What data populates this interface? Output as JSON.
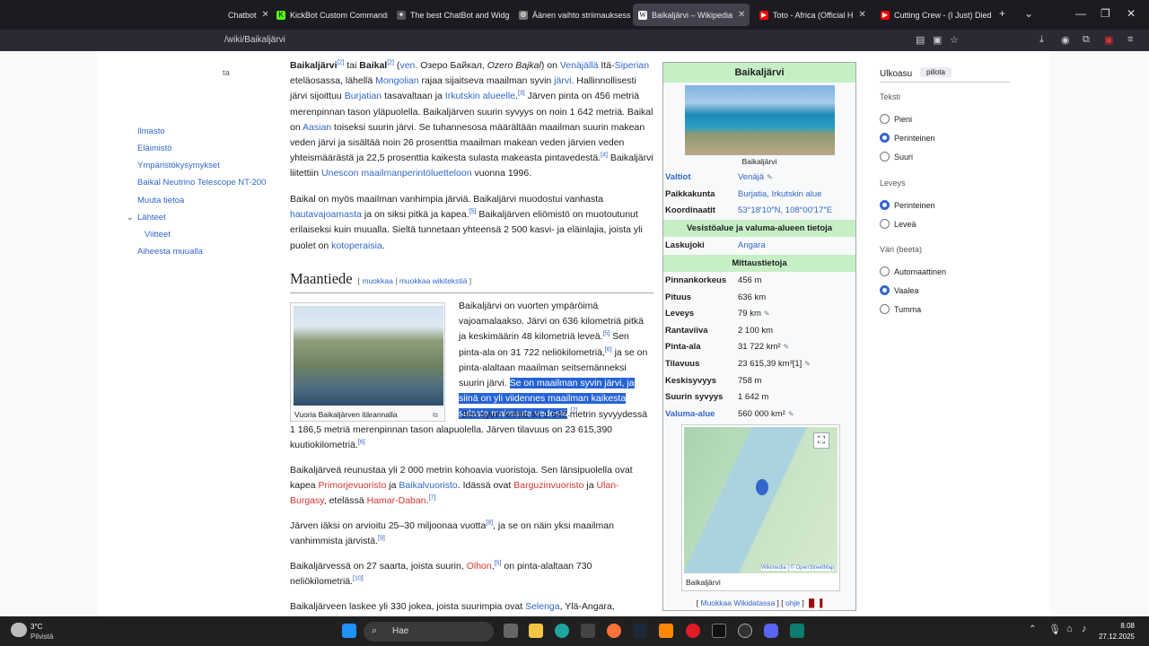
{
  "tabs": [
    {
      "label": "Chatbot",
      "icon": "tab-icon",
      "color": "#444"
    },
    {
      "label": "KickBot Custom Commands",
      "icon": "kickbot-icon",
      "color": "#53fc18"
    },
    {
      "label": "The best ChatBot and Widg",
      "icon": "streamelements-icon",
      "color": "#555"
    },
    {
      "label": "Äänen vaihto striimauksess",
      "icon": "chatgpt-icon",
      "color": "#777"
    },
    {
      "label": "Baikaljärvi – Wikipedia",
      "icon": "wikipedia-icon",
      "color": "#fff"
    },
    {
      "label": "Toto - Africa (Official H",
      "icon": "youtube-icon",
      "color": "#ff0000"
    },
    {
      "label": "Cutting Crew - (I Just) Died",
      "icon": "youtube-icon",
      "color": "#ff0000"
    }
  ],
  "url": "/wiki/Baikaljärvi",
  "toc": [
    "Ilmasto",
    "Eläimistö",
    "Ympäristökysymykset",
    "Baikal Neutrino Telescope NT-200",
    "Muuta tietoa",
    "Lähteet",
    "Viitteet",
    "Aiheesta muualla"
  ],
  "toc_partial": "ta",
  "article": {
    "p1": {
      "b1": "Baikaljärvi",
      "s1": "[2]",
      "t1": " tai ",
      "b2": "Baikal",
      "s2": "[2]",
      "t2": " (",
      "l1": "ven.",
      "t3": " Озеро Байкал, ",
      "i1": "Ozero Bajkal",
      "t4": ") on ",
      "l2": "Venäjällä",
      "t5": " Itä-",
      "l3": "Siperian",
      "t6": " eteläosassa, lähellä ",
      "l4": "Mongolian",
      "t7": " rajaa sijaitseva maailman syvin ",
      "l5": "järvi",
      "t8": ". Hallinnollisesti järvi sijoittuu ",
      "l6": "Burjatian",
      "t9": " tasavaltaan ja ",
      "l7": "Irkutskin alueelle",
      "t10": ".",
      "s3": "[3]",
      "t11": " Järven pinta on 456 metriä merenpinnan tason yläpuolella. Baikaljärven suurin syvyys on noin 1 642 metriä. Baikal on ",
      "l8": "Aasian",
      "t12": " toiseksi suurin järvi. Se tuhannesosa määrältään maailman suurin makean veden järvi ja sisältää noin 26 prosenttia maailman makean veden järvien veden yhteismäärästä ja 22,5 prosenttia kaikesta sulasta makeasta pintavedestä.",
      "s4": "[4]",
      "t13": " Baikaljärvi liitettiin ",
      "l9": "Unescon maailmanperintöluetteloon",
      "t14": " vuonna 1996."
    },
    "p2": {
      "t1": "Baikal on myös maailman vanhimpia järviä. Baikaljärvi muodostui vanhasta ",
      "l1": "hautavajoamasta",
      "t2": " ja on siksi pitkä ja kapea.",
      "s1": "[5]",
      "t3": " Baikaljärven eliömistö on muotoutunut erilaiseksi kuin muualla. Sieltä tunnetaan yhteensä 2 500 kasvi- ja eläinlajia, joista yli puolet on ",
      "l2": "kotoperaisia",
      "t4": "."
    },
    "heading": "Maantiede",
    "edit1": "muokkaa",
    "edit2": "muokkaa wikitekstiä",
    "thumb_caption": "Vuoria Baikaljärven itärannalla",
    "p3": {
      "t1": "Baikaljärvi on vuorten ympäröimä vajoamalaakso. Järvi on 636 kilometriä pitkä ja keskimäärin 48 kilometriä leveä.",
      "s1": "[5]",
      "t2": " Sen pinta-ala on 31 722 neliökilometriä,",
      "s2": "[6]",
      "t3": " ja se on pinta-alaltaan maailman seitsemänneksi suurin järvi. ",
      "h1": "Se on maailman syvin järvi, ja siinä on yli viidennes maailman kaikesta sulasta makeasta vedestä",
      "t4": ".",
      "s3": "[7]",
      "t5": " Sen syvin kohta on 1 642 metrin syvyydessä 1 186,5 metriä merenpinnan tason alapuolella. Järven tilavuus on 23 615,390 kuutiokilometriä.",
      "s4": "[6]"
    },
    "p4": {
      "t1": "Baikaljärveä reunustaa yli 2 000 metrin kohoavia vuoristoja. Sen länsipuolella ovat kapea ",
      "l1": "Primorjevuoristo",
      "t2": " ja ",
      "l2": "Baikalvuoristo",
      "t3": ". Idässä ovat ",
      "l3": "Barguzinvuoristo",
      "t4": " ja ",
      "l4": "Ulan-Burgasy",
      "t5": ", etelässä ",
      "l5": "Hamar-Daban",
      "t6": ".",
      "s1": "[7]"
    },
    "p5": {
      "t1": "Järven iäksi on arvioitu 25–30 miljoonaa vuotta",
      "s1": "[8]",
      "t2": ", ja se on näin yksi maailman vanhimmista järvistä.",
      "s2": "[9]"
    },
    "p6": {
      "t1": "Baikaljärvessä on 27 saarta, joista suurin, ",
      "l1": "Olhon",
      "t2": ",",
      "s1": "[5]",
      "t3": " on pinta-alaltaan 730 neliökilometriä.",
      "s2": "[10]"
    },
    "p7": {
      "t1": "Baikaljärveen laskee yli 330 jokea, joista suurimpia ovat ",
      "l1": "Selenga",
      "t2": ", Ylä-Angara,"
    }
  },
  "infobox": {
    "title": "Baikaljärvi",
    "image_caption": "Baikaljärvi",
    "rows1": [
      {
        "k": "Valtiot",
        "v": "Venäjä",
        "klink": true,
        "vlink": true,
        "pen": true
      },
      {
        "k": "Paikkakunta",
        "v": "Burjatia, Irkutskin alue",
        "klink": false,
        "vlink": true,
        "pen": false
      },
      {
        "k": "Koordinaatit",
        "v": "53°18′10″N, 108°00′17″E",
        "klink": false,
        "vlink": true,
        "pen": false
      }
    ],
    "section1": "Vesistöalue ja valuma-alueen tietoja",
    "rows2": [
      {
        "k": "Laskujoki",
        "v": "Angara",
        "klink": false,
        "vlink": true,
        "pen": false
      }
    ],
    "section2": "Mittaustietoja",
    "rows3": [
      {
        "k": "Pinnankorkeus",
        "v": "456 m",
        "klink": false,
        "vlink": false,
        "pen": false
      },
      {
        "k": "Pituus",
        "v": "636 km",
        "klink": false,
        "vlink": false,
        "pen": false
      },
      {
        "k": "Leveys",
        "v": "79 km",
        "klink": false,
        "vlink": false,
        "pen": true
      },
      {
        "k": "Rantaviiva",
        "v": "2 100 km",
        "klink": false,
        "vlink": false,
        "pen": false
      },
      {
        "k": "Pinta-ala",
        "v": "31 722 km²",
        "klink": false,
        "vlink": false,
        "pen": true
      },
      {
        "k": "Tilavuus",
        "v": "23 615,39 km³[1]",
        "klink": false,
        "vlink": false,
        "pen": true
      },
      {
        "k": "Keskisyvyys",
        "v": "758 m",
        "klink": false,
        "vlink": false,
        "pen": false
      },
      {
        "k": "Suurin syvyys",
        "v": "1 642 m",
        "klink": false,
        "vlink": false,
        "pen": false
      },
      {
        "k": "Valuma-alue",
        "v": "560 000 km²",
        "klink": true,
        "vlink": false,
        "pen": true
      }
    ],
    "map_caption": "Baikaljärvi",
    "map_attrib": "Wikimedia | © OpenStreetMap",
    "footer_edit": "Muokkaa Wikidatassa",
    "footer_help": "ohje"
  },
  "panel": {
    "title": "Ulkoasu",
    "hide": "piilota",
    "text_label": "Teksti",
    "text_options": [
      "Pieni",
      "Perinteinen",
      "Suuri"
    ],
    "text_selected": 1,
    "width_label": "Leveys",
    "width_options": [
      "Perinteinen",
      "Leveä"
    ],
    "width_selected": 0,
    "color_label": "Väri (beeta)",
    "color_options": [
      "Automaattinen",
      "Vaalea",
      "Tumma"
    ],
    "color_selected": 1
  },
  "taskbar": {
    "weather_temp": "3°C",
    "weather_desc": "Pilvistä",
    "search_placeholder": "Hae",
    "time": "8.08",
    "date": "27.12.2025"
  }
}
